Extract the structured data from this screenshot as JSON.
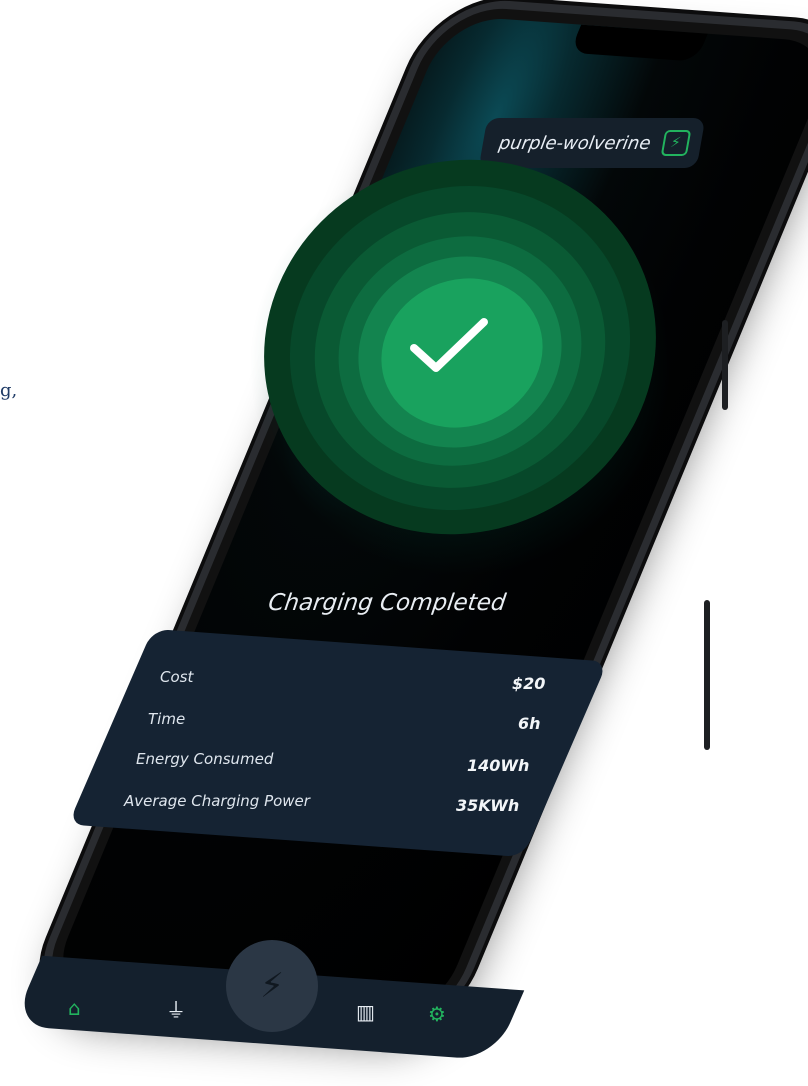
{
  "side_text": "g,",
  "device_name": "purple-wolverine",
  "status": "Charging Completed",
  "details": [
    {
      "label": "Cost",
      "value": "$20"
    },
    {
      "label": "Time",
      "value": "6h"
    },
    {
      "label": "Energy Consumed",
      "value": "140Wh"
    },
    {
      "label": "Average Charging Power",
      "value": "35KWh"
    }
  ],
  "nav": [
    {
      "name": "home",
      "icon": "home-icon",
      "active": true
    },
    {
      "name": "charger",
      "icon": "plug-icon",
      "active": false
    },
    {
      "name": "charge",
      "icon": "lightning-icon",
      "active": false
    },
    {
      "name": "stats",
      "icon": "bar-chart-icon",
      "active": false
    },
    {
      "name": "settings",
      "icon": "gear-icon",
      "active": true
    }
  ],
  "colors": {
    "accent": "#22b35e",
    "card": "#152333",
    "background": "#000000"
  }
}
